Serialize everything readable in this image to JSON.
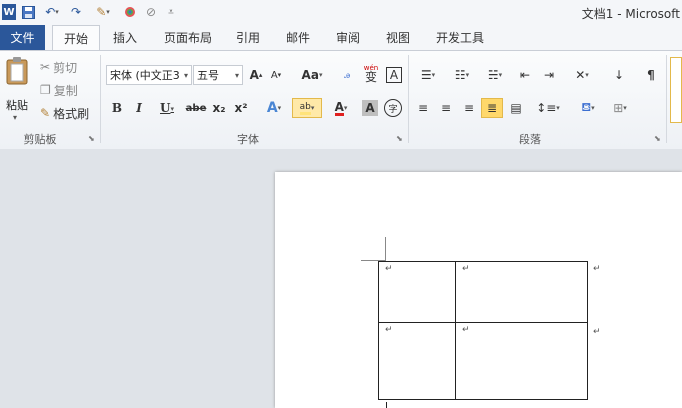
{
  "qat": {
    "icons": [
      "word-logo-icon",
      "save-icon",
      "undo-icon",
      "redo-icon",
      "format-painter-icon",
      "color-icon",
      "clear-icon",
      "customize-qat-icon"
    ]
  },
  "title": "文档1 - Microsoft",
  "tabs": {
    "file": "文件",
    "items": [
      "开始",
      "插入",
      "页面布局",
      "引用",
      "邮件",
      "审阅",
      "视图",
      "开发工具"
    ]
  },
  "clipboard": {
    "paste": "粘贴",
    "cut": "剪切",
    "copy": "复制",
    "format_painter": "格式刷",
    "group": "剪贴板"
  },
  "font": {
    "name": "宋体 (中文正3",
    "size": "五号",
    "grow": "A",
    "shrink": "A",
    "change_case": "Aa",
    "pinyin": "wén",
    "phonetic": "变",
    "char_border": "A",
    "bold": "B",
    "italic": "I",
    "underline": "U",
    "strike": "abe",
    "subscript": "x₂",
    "superscript": "x²",
    "text_effect": "A",
    "highlight": "ab",
    "font_color": "A",
    "shading": "A",
    "enclose": "字",
    "group": "字体"
  },
  "paragraph": {
    "group": "段落"
  },
  "colors": {
    "accent": "#2b579a",
    "highlight": "#ffe37a",
    "font_red": "#e02020"
  },
  "document": {
    "cell_mark": "↵",
    "rows": 2,
    "cols": 2
  }
}
